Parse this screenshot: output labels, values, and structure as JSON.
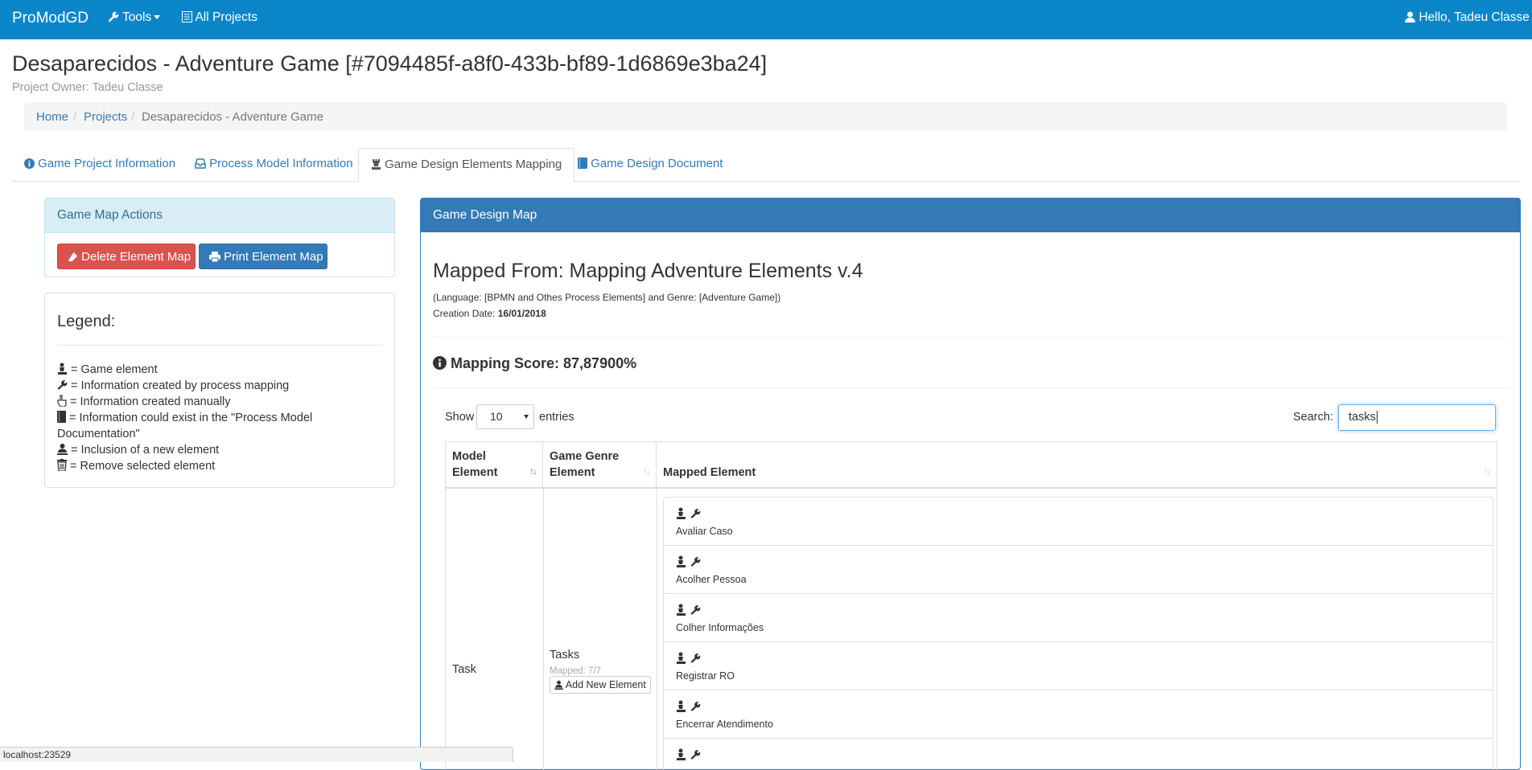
{
  "navbar": {
    "brand": "ProModGD",
    "tools_label": "Tools",
    "all_projects_label": "All Projects",
    "user_label": "Hello, Tadeu Classe"
  },
  "header": {
    "title": "Desaparecidos - Adventure Game [#7094485f-a8f0-433b-bf89-1d6869e3ba24]",
    "owner": "Project Owner: Tadeu Classe"
  },
  "breadcrumb": [
    "Home",
    "Projects",
    "Desaparecidos - Adventure Game"
  ],
  "tabs": [
    {
      "label": "Game Project Information",
      "icon": "info-icon"
    },
    {
      "label": "Process Model Information",
      "icon": "inbox-icon"
    },
    {
      "label": "Game Design Elements Mapping",
      "icon": "chess-icon",
      "active": true
    },
    {
      "label": "Game Design Document",
      "icon": "book-icon"
    }
  ],
  "actions": {
    "title": "Game Map Actions",
    "delete_label": "Delete Element Map",
    "print_label": "Print Element Map"
  },
  "legend": {
    "title": "Legend:",
    "items": [
      {
        "icon": "chess-piece-icon",
        "text": "= Game element"
      },
      {
        "icon": "wrench-icon",
        "text": "= Information created by process mapping"
      },
      {
        "icon": "hand-pointer-icon",
        "text": "= Information created manually"
      },
      {
        "icon": "book-icon",
        "text": "= Information could exist in the \"Process Model Documentation\""
      },
      {
        "icon": "add-user-icon",
        "text": "= Inclusion of a new element"
      },
      {
        "icon": "trash-icon",
        "text": "= Remove selected element"
      }
    ]
  },
  "map": {
    "panel_title": "Game Design Map",
    "mapped_from": "Mapped From: Mapping Adventure Elements v.4",
    "language_line": "(Language: [BPMN and Othes Process Elements] and Genre: [Adventure Game])",
    "creation_label": "Creation Date:",
    "creation_date": "16/01/2018",
    "score": "Mapping Score: 87,87900%",
    "show_label": "Show",
    "entries_value": "10",
    "entries_label": "entries",
    "search_label": "Search:",
    "search_value": "tasks",
    "columns": [
      "Model Element",
      "Game Genre Element",
      "Mapped Element"
    ],
    "row": {
      "model_element": "Task",
      "genre_element": "Tasks",
      "mapped_count": "Mapped: 7/7",
      "add_label": "Add New Element",
      "elements": [
        "Avaliar Caso",
        "Acolher Pessoa",
        "Colher Informações",
        "Registrar RO",
        "Encerrar Atendimento",
        ""
      ]
    }
  },
  "statusbar": "localhost:23529",
  "colors": {
    "navbar": "#0a86c8",
    "primary": "#337ab7",
    "danger": "#d9534f",
    "info_bg": "#d9edf7"
  }
}
